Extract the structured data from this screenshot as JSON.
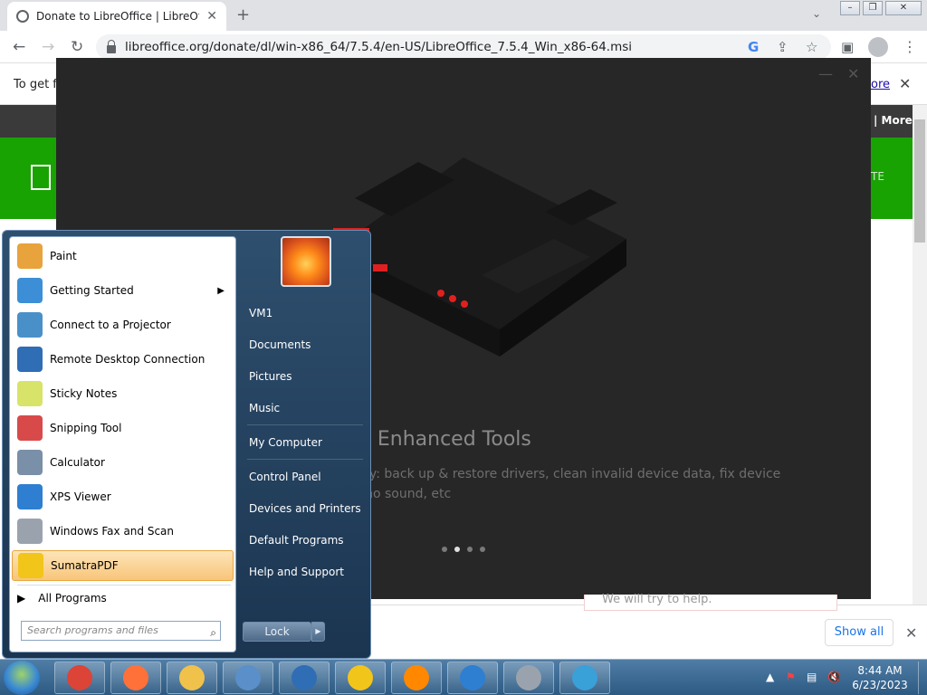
{
  "browser": {
    "tab_title": "Donate to LibreOffice | LibreOffice",
    "new_tab_glyph": "+",
    "url": "libreoffice.org/donate/dl/win-x86_64/7.5.4/en-US/LibreOffice_7.5.4_Win_x86-64.msi",
    "infobar_text": "To get fu",
    "infobar_link": "ore",
    "nav_more": "| More..."
  },
  "overlay": {
    "title": "round Enhanced Tools",
    "description": "horoughly: back up & restore drivers, clean invalid device data, fix device error or no sound, etc",
    "active_dot": 1
  },
  "download_bar": {
    "peek_text": "We will try to help.",
    "show_all": "Show all"
  },
  "start_menu": {
    "programs": [
      {
        "label": "Paint",
        "icon": "paint-icon",
        "color": "#e8a33c"
      },
      {
        "label": "Getting Started",
        "icon": "getting-started-icon",
        "color": "#3c8fd6",
        "submenu": true
      },
      {
        "label": "Connect to a Projector",
        "icon": "projector-icon",
        "color": "#4a90c8"
      },
      {
        "label": "Remote Desktop Connection",
        "icon": "remote-desktop-icon",
        "color": "#2f6db5"
      },
      {
        "label": "Sticky Notes",
        "icon": "sticky-notes-icon",
        "color": "#d8e36a"
      },
      {
        "label": "Snipping Tool",
        "icon": "snipping-tool-icon",
        "color": "#d84a4a"
      },
      {
        "label": "Calculator",
        "icon": "calculator-icon",
        "color": "#7a8fa8"
      },
      {
        "label": "XPS Viewer",
        "icon": "xps-viewer-icon",
        "color": "#2e7fd1"
      },
      {
        "label": "Windows Fax and Scan",
        "icon": "fax-scan-icon",
        "color": "#9aa3ad"
      },
      {
        "label": "SumatraPDF",
        "icon": "sumatrapdf-icon",
        "color": "#f2c51b",
        "selected": true
      }
    ],
    "all_programs": "All Programs",
    "search_placeholder": "Search programs and files",
    "right_items": [
      "VM1",
      "Documents",
      "Pictures",
      "Music",
      "My Computer",
      "Control Panel",
      "Devices and Printers",
      "Default Programs",
      "Help and Support"
    ],
    "lock_label": "Lock"
  },
  "taskbar": {
    "apps": [
      {
        "name": "chrome",
        "color": "#db4437"
      },
      {
        "name": "firefox",
        "color": "#ff7139"
      },
      {
        "name": "file-explorer",
        "color": "#f0c24b"
      },
      {
        "name": "control-panel",
        "color": "#5b8fc9"
      },
      {
        "name": "remote-desktop",
        "color": "#2f6db5"
      },
      {
        "name": "sumatrapdf",
        "color": "#f2c51b"
      },
      {
        "name": "vlc",
        "color": "#ff8800"
      },
      {
        "name": "xps-viewer",
        "color": "#2e7fd1"
      },
      {
        "name": "fax-scan",
        "color": "#9aa3ad"
      },
      {
        "name": "10bit-app",
        "color": "#3aa0d8"
      }
    ],
    "time": "8:44 AM",
    "date": "6/23/2023"
  }
}
